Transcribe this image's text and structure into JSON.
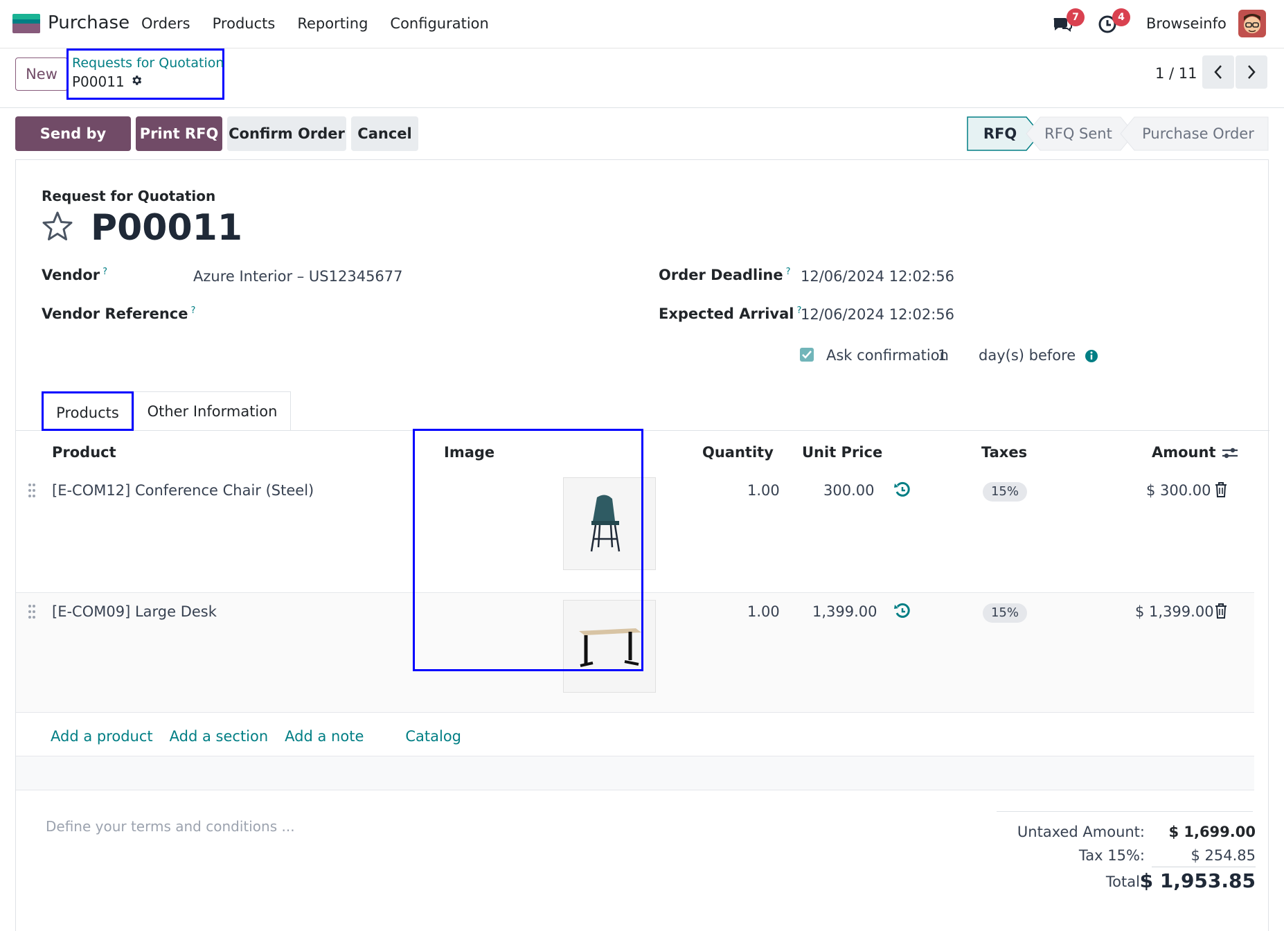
{
  "navbar": {
    "app_name": "Purchase",
    "menu": [
      "Orders",
      "Products",
      "Reporting",
      "Configuration"
    ],
    "messages_count": "7",
    "activities_count": "4",
    "company": "Browseinfo"
  },
  "control": {
    "new_label": "New",
    "breadcrumb_parent": "Requests for Quotation",
    "breadcrumb_current": "P00011",
    "pager": "1 / 11"
  },
  "statusbar": {
    "buttons": [
      "Send by Email",
      "Print RFQ",
      "Confirm Order",
      "Cancel"
    ],
    "stages": [
      "RFQ",
      "RFQ Sent",
      "Purchase Order"
    ],
    "active_stage": "RFQ"
  },
  "form": {
    "header_label": "Request for Quotation",
    "title": "P00011",
    "vendor_label": "Vendor",
    "vendor_value": "Azure Interior – US12345677",
    "vendor_ref_label": "Vendor Reference",
    "vendor_ref_value": "",
    "help_mark": "?",
    "deadline_label": "Order Deadline",
    "deadline_value": "12/06/2024 12:02:56",
    "arrival_label": "Expected Arrival",
    "arrival_value": "12/06/2024 12:02:56",
    "ask_confirm_label": "Ask confirmation",
    "ask_confirm_days": "1",
    "ask_confirm_suffix": "day(s) before"
  },
  "tabs": [
    "Products",
    "Other Information"
  ],
  "table": {
    "headers": [
      "Product",
      "Image",
      "Quantity",
      "Unit Price",
      "Taxes",
      "Amount"
    ],
    "rows": [
      {
        "product": "[E-COM12] Conference Chair (Steel)",
        "quantity": "1.00",
        "unit_price": "300.00",
        "taxes": "15%",
        "amount": "$ 300.00"
      },
      {
        "product": "[E-COM09] Large Desk",
        "quantity": "1.00",
        "unit_price": "1,399.00",
        "taxes": "15%",
        "amount": "$ 1,399.00"
      }
    ],
    "add_links": [
      "Add a product",
      "Add a section",
      "Add a note",
      "Catalog"
    ]
  },
  "footer": {
    "terms_placeholder": "Define your terms and conditions ...",
    "untaxed_label": "Untaxed Amount:",
    "untaxed_value": "$ 1,699.00",
    "tax_label": "Tax 15%:",
    "tax_value": "$ 254.85",
    "total_label": "Total:",
    "total_value": "$ 1,953.85"
  },
  "colors": {
    "primary": "#714b67",
    "link": "#017e84",
    "highlight": "#0000ff"
  }
}
